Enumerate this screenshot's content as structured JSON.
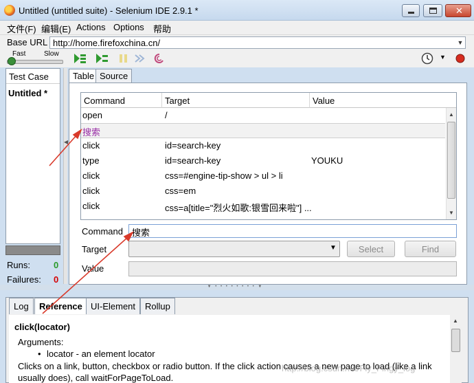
{
  "window": {
    "title": "Untitled (untitled suite) - Selenium IDE 2.9.1 *"
  },
  "menu": {
    "items": [
      "文件(F)",
      "编辑(E)",
      "Actions",
      "Options",
      "帮助"
    ]
  },
  "base_url": {
    "label": "Base URL",
    "value": "http://home.firefoxchina.cn/"
  },
  "speed": {
    "fast": "Fast",
    "slow": "Slow"
  },
  "test_case": {
    "header": "Test Case",
    "items": [
      "Untitled *"
    ]
  },
  "stats": {
    "runs_label": "Runs:",
    "runs_value": "0",
    "failures_label": "Failures:",
    "failures_value": "0",
    "runs_color": "#2a9a2a",
    "failures_color": "#d40000"
  },
  "editor_tabs": [
    "Table",
    "Source"
  ],
  "table": {
    "headers": [
      "Command",
      "Target",
      "Value"
    ],
    "rows": [
      {
        "command": "open",
        "target": "/",
        "value": ""
      },
      {
        "command": "搜索",
        "target": "",
        "value": "",
        "comment": true,
        "selected": true
      },
      {
        "command": "click",
        "target": "id=search-key",
        "value": ""
      },
      {
        "command": "type",
        "target": "id=search-key",
        "value": "YOUKU"
      },
      {
        "command": "click",
        "target": "css=#engine-tip-show > ul > li",
        "value": ""
      },
      {
        "command": "click",
        "target": "css=em",
        "value": ""
      },
      {
        "command": "click",
        "target": "css=a[title=\"烈火如歌:银雪回来啦\"] ...",
        "value": ""
      }
    ]
  },
  "form": {
    "command_label": "Command",
    "command_value": "搜索",
    "target_label": "Target",
    "value_label": "Value",
    "select_button": "Select",
    "find_button": "Find"
  },
  "bottom_tabs": [
    "Log",
    "Reference",
    "UI-Element",
    "Rollup"
  ],
  "reference": {
    "title": "click(locator)",
    "arguments_label": "Arguments:",
    "argument_item": "locator - an element locator",
    "description": "Clicks on a link, button, checkbox or radio button. If the click action causes a new page to load (like a link usually does), call waitForPageToLoad."
  },
  "watermark": "http://blog.csdn.net/Fly_Fingy_log",
  "colors": {
    "accent": "#d93a2b",
    "comment_text": "#9a2fa6"
  }
}
